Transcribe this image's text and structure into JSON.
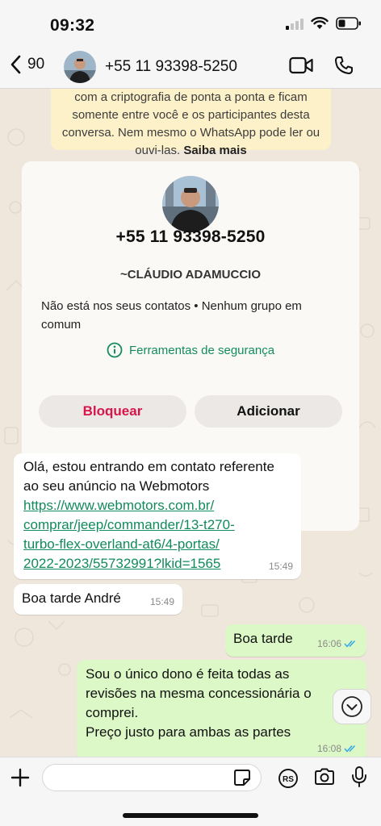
{
  "status_bar": {
    "time": "09:32"
  },
  "header": {
    "back_count": "90",
    "title": "+55 11 93398-5250"
  },
  "encryption_note": {
    "text": "com a criptografia de ponta a ponta e ficam somente entre você e os participantes desta conversa. Nem mesmo o WhatsApp pode ler ou ouvi-las.",
    "link": "Saiba mais"
  },
  "contact_card": {
    "phone": "+55 11 93398-5250",
    "name": "~CLÁUDIO ADAMUCCIO",
    "info": "Não está nos seus contatos • Nenhum grupo em comum",
    "tools": "Ferramentas de segurança",
    "block_label": "Bloquear",
    "add_label": "Adicionar"
  },
  "messages": [
    {
      "direction": "in",
      "text": "Olá, estou entrando em contato referente ao seu anúncio na Webmotors",
      "link": "https://www.webmotors.com.br/comprar/jeep/commander/13-t270-turbo-flex-overland-at6/4-portas/2022-2023/55732991?lkid=1565",
      "link_lines": [
        "https://www.webmotors.com.br/",
        "comprar/jeep/commander/13-t270-",
        "turbo-flex-overland-at6/4-portas/",
        "2022-2023/55732991?lkid=1565"
      ],
      "time": "15:49"
    },
    {
      "direction": "in",
      "text": "Boa tarde André",
      "time": "15:49"
    },
    {
      "direction": "out",
      "text": "Boa tarde",
      "time": "16:06"
    },
    {
      "direction": "out",
      "lines": [
        "Sou o único dono é feita todas as",
        "revisões na mesma concessionária o",
        "comprei.",
        "Preço justo para ambas as partes"
      ],
      "time": "16:08"
    }
  ],
  "composer": {
    "placeholder": "",
    "rs_label": "RS"
  },
  "colors": {
    "accent_green": "#128c5e",
    "block_red": "#d6154a",
    "outgoing_bubble": "#dcf8c6",
    "read_ticks": "#34a7e8",
    "encryption_bg": "#fcf1c8"
  },
  "icons": {
    "back": "chevron-left-icon",
    "video": "video-camera-icon",
    "call": "phone-icon",
    "tools": "info-circle-icon",
    "scroll": "chevron-down-icon",
    "plus": "plus-icon",
    "sticker": "sticker-icon",
    "camera": "camera-icon",
    "mic": "microphone-icon"
  }
}
